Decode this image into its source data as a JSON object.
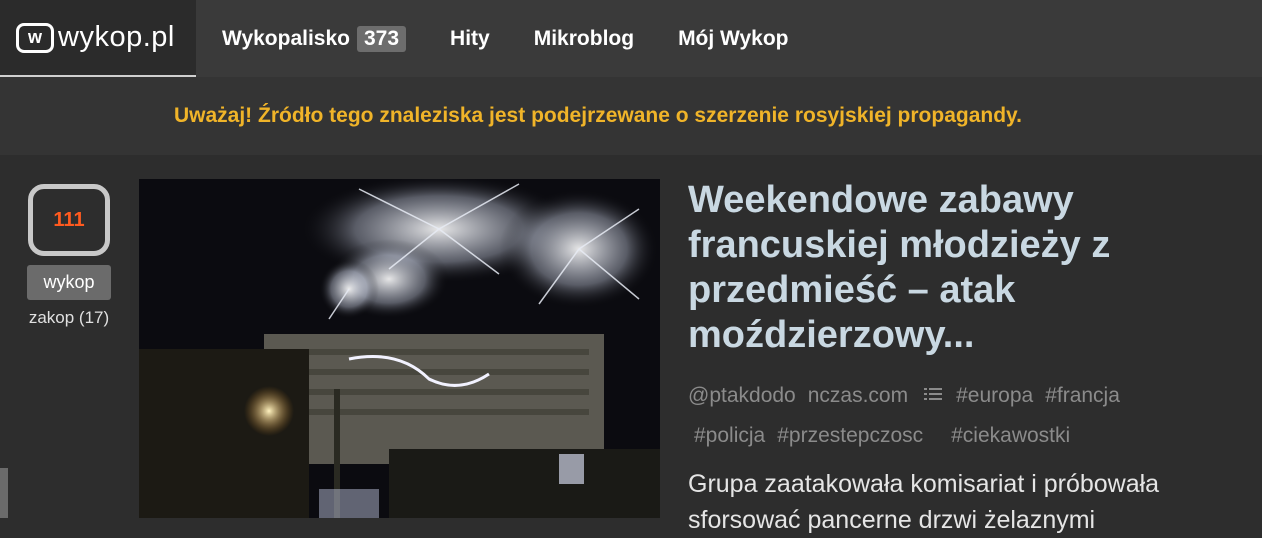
{
  "header": {
    "logo_mark": "w",
    "logo_text": "wykop.pl",
    "nav": [
      {
        "label": "Wykopalisko",
        "badge": "373"
      },
      {
        "label": "Hity"
      },
      {
        "label": "Mikroblog"
      },
      {
        "label": "Mój Wykop"
      }
    ]
  },
  "warning": "Uważaj! Źródło tego znaleziska jest podejrzewane o szerzenie rosyjskiej propagandy.",
  "vote": {
    "count": "111",
    "button": "wykop",
    "bury": "zakop (17)"
  },
  "article": {
    "title": "Weekendowe zabawy francuskiej młodzieży z przedmieść – atak moździerzowy...",
    "author": "@ptakdodo",
    "source": "nczas.com",
    "tags": [
      "#europa",
      "#francja",
      "#policja",
      "#przestepczosc",
      "#ciekawostki"
    ],
    "description": "Grupa zaatakowała komisariat i próbowała sforsować pancerne drzwi żelaznymi"
  },
  "colors": {
    "warning_text": "#f0b429",
    "vote_count": "#ff5a1f",
    "title": "#c9d8e2"
  }
}
